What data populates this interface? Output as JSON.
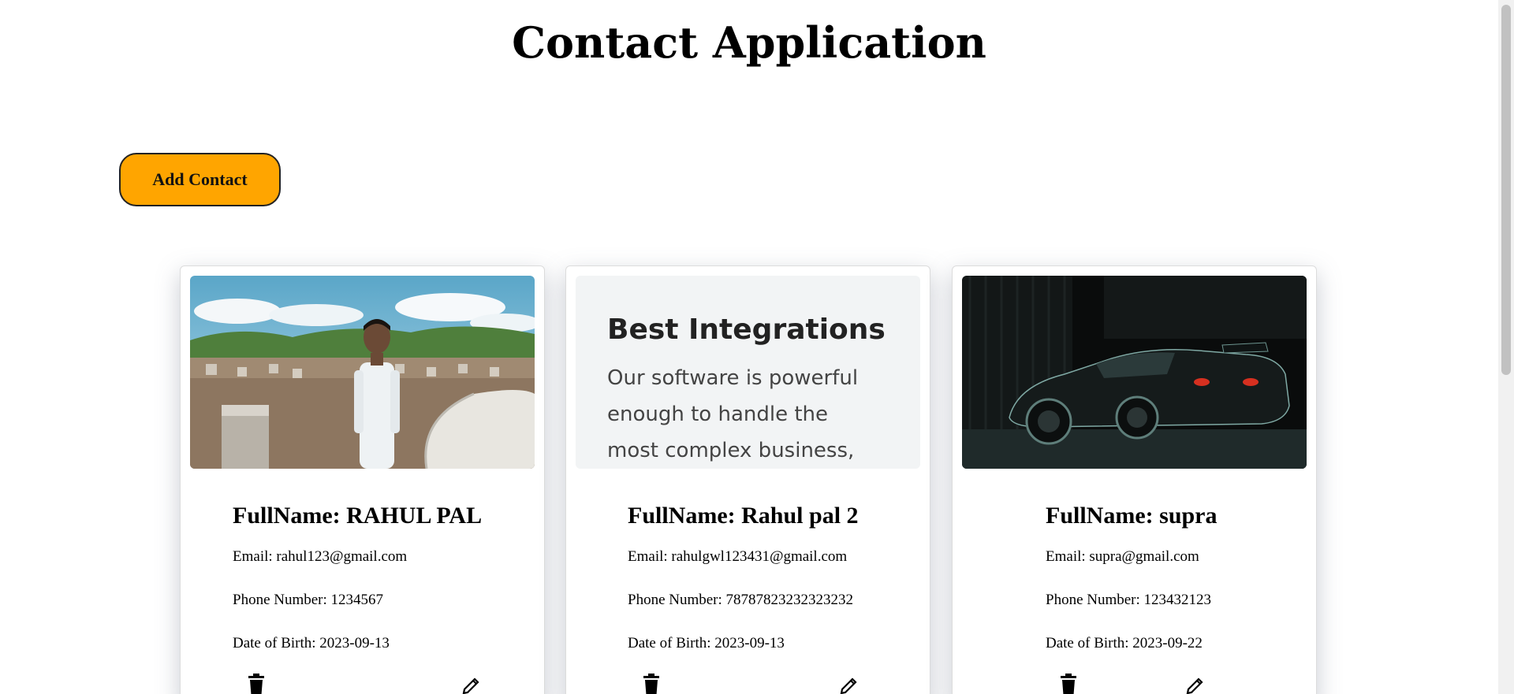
{
  "header": {
    "title": "Contact Application"
  },
  "toolbar": {
    "add_label": "Add Contact"
  },
  "contacts": [
    {
      "name_prefix": "FullName:",
      "name": "RAHUL PAL",
      "email_prefix": "Email:",
      "email": "rahul123@gmail.com",
      "phone_prefix": "Phone Number:",
      "phone": "1234567",
      "dob_prefix": "Date of Birth:",
      "dob": "2023-09-13",
      "image": "person-photo"
    },
    {
      "name_prefix": "FullName:",
      "name": "Rahul pal 2",
      "email_prefix": "Email:",
      "email": "rahulgwl123431@gmail.com",
      "phone_prefix": "Phone Number:",
      "phone": "78787823232323232",
      "dob_prefix": "Date of Birth:",
      "dob": "2023-09-13",
      "image": "text-graphic",
      "image_heading": "Best Integrations",
      "image_body": [
        "Our software is powerful",
        "enough to handle the",
        "most complex business,"
      ]
    },
    {
      "name_prefix": "FullName:",
      "name": "supra",
      "email_prefix": "Email:",
      "email": "supra@gmail.com",
      "phone_prefix": "Phone Number:",
      "phone": "123432123",
      "dob_prefix": "Date of Birth:",
      "dob": "2023-09-22",
      "image": "car-photo"
    }
  ],
  "icons": {
    "delete": "trash-icon",
    "edit": "pencil-icon"
  },
  "colors": {
    "accent": "#ffa500"
  }
}
